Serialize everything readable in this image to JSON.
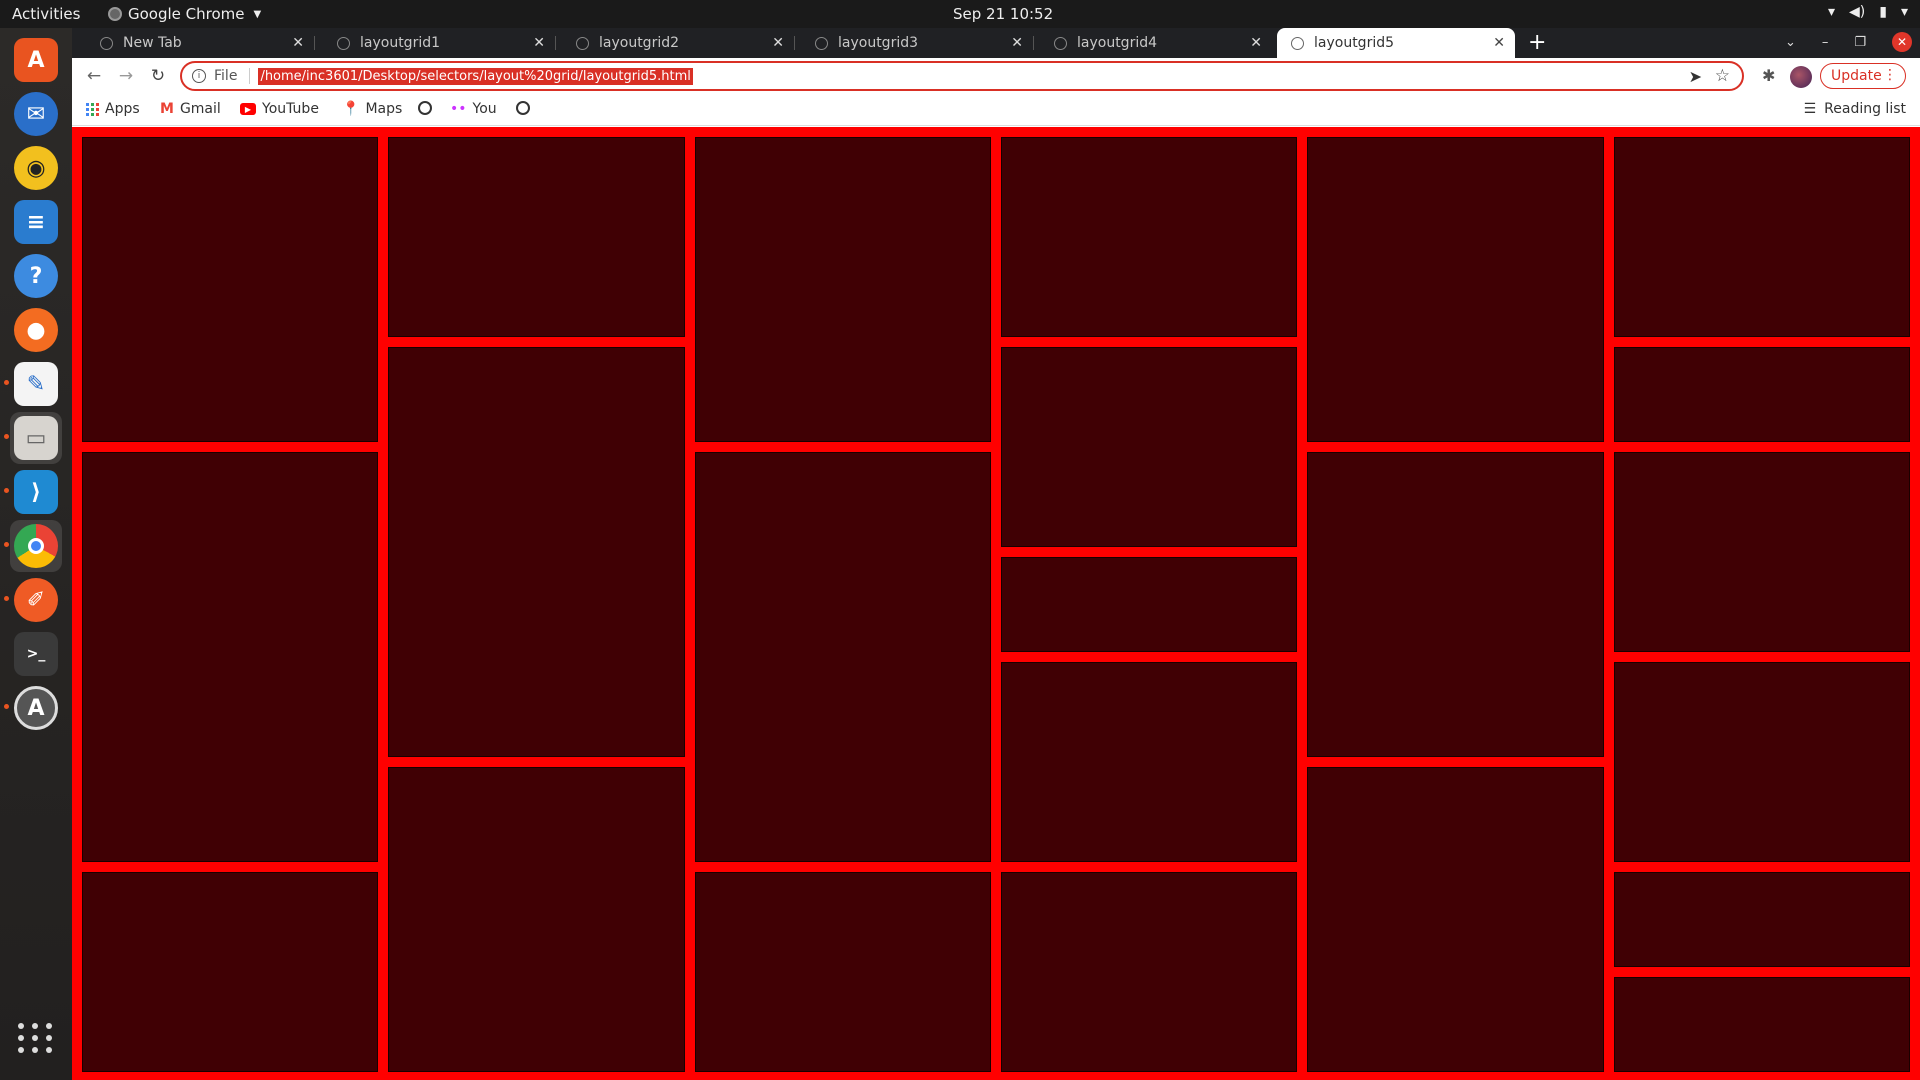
{
  "topbar": {
    "activities": "Activities",
    "app_name": "Google Chrome",
    "clock": "Sep 21  10:52"
  },
  "dock": {
    "items": [
      "ubuntu-software",
      "thunderbird",
      "rhythmbox",
      "libreoffice-writer",
      "help",
      "firefox",
      "text-editor",
      "files",
      "vscode",
      "chrome",
      "postman",
      "terminal",
      "software-updater"
    ]
  },
  "browser": {
    "tabs": [
      {
        "label": "New Tab"
      },
      {
        "label": "layoutgrid1"
      },
      {
        "label": "layoutgrid2"
      },
      {
        "label": "layoutgrid3"
      },
      {
        "label": "layoutgrid4"
      },
      {
        "label": "layoutgrid5"
      }
    ],
    "omnibox": {
      "scheme_label": "File",
      "url": "/home/inc3601/Desktop/selectors/layout%20grid/layoutgrid5.html"
    },
    "update_label": "Update",
    "bookmarks": [
      {
        "label": "Apps"
      },
      {
        "label": "Gmail"
      },
      {
        "label": "YouTube"
      },
      {
        "label": "Maps"
      },
      {
        "label": ""
      },
      {
        "label": "You"
      },
      {
        "label": ""
      }
    ],
    "reading_list": "Reading list"
  },
  "page": {
    "background_color": "#ff0000",
    "cell_color": "#400004",
    "grid_columns": 6,
    "grid_rows": 9,
    "columns": [
      {
        "spans": [
          3,
          4,
          2
        ]
      },
      {
        "spans": [
          2,
          4,
          3
        ]
      },
      {
        "spans": [
          3,
          4,
          2
        ]
      },
      {
        "spans": [
          2,
          2,
          1,
          2,
          2
        ]
      },
      {
        "spans": [
          3,
          3,
          3
        ]
      },
      {
        "spans": [
          2,
          1,
          2,
          2,
          1,
          1
        ]
      }
    ]
  }
}
